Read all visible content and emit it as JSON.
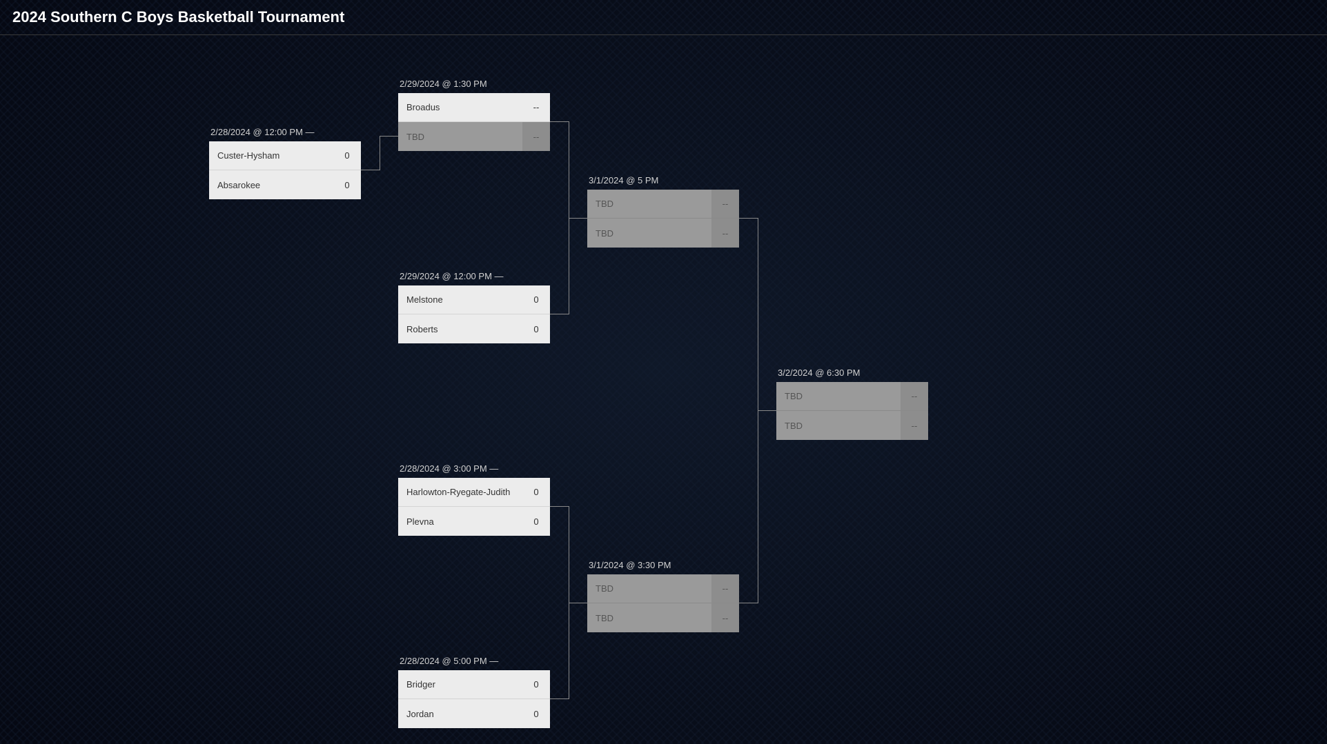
{
  "title": "2024 Southern C Boys Basketball Tournament",
  "matches": {
    "r1m1": {
      "date": "2/28/2024 @ 12:00 PM —",
      "team1": {
        "name": "Custer-Hysham",
        "score": "0",
        "tbd": false
      },
      "team2": {
        "name": "Absarokee",
        "score": "0",
        "tbd": false
      }
    },
    "r2m1": {
      "date": "2/29/2024 @ 1:30 PM",
      "team1": {
        "name": "Broadus",
        "score": "--",
        "tbd": false
      },
      "team2": {
        "name": "TBD",
        "score": "--",
        "tbd": true
      }
    },
    "r2m2": {
      "date": "2/29/2024 @ 12:00 PM —",
      "team1": {
        "name": "Melstone",
        "score": "0",
        "tbd": false
      },
      "team2": {
        "name": "Roberts",
        "score": "0",
        "tbd": false
      }
    },
    "r2m3": {
      "date": "2/28/2024 @ 3:00 PM —",
      "team1": {
        "name": "Harlowton-Ryegate-Judith",
        "score": "0",
        "tbd": false
      },
      "team2": {
        "name": "Plevna",
        "score": "0",
        "tbd": false
      }
    },
    "r2m4": {
      "date": "2/28/2024 @ 5:00 PM —",
      "team1": {
        "name": "Bridger",
        "score": "0",
        "tbd": false
      },
      "team2": {
        "name": "Jordan",
        "score": "0",
        "tbd": false
      }
    },
    "r3m1": {
      "date": "3/1/2024 @ 5 PM",
      "team1": {
        "name": "TBD",
        "score": "--",
        "tbd": true
      },
      "team2": {
        "name": "TBD",
        "score": "--",
        "tbd": true
      }
    },
    "r3m2": {
      "date": "3/1/2024 @ 3:30 PM",
      "team1": {
        "name": "TBD",
        "score": "--",
        "tbd": true
      },
      "team2": {
        "name": "TBD",
        "score": "--",
        "tbd": true
      }
    },
    "r4m1": {
      "date": "3/2/2024 @ 6:30 PM",
      "team1": {
        "name": "TBD",
        "score": "--",
        "tbd": true
      },
      "team2": {
        "name": "TBD",
        "score": "--",
        "tbd": true
      }
    }
  }
}
